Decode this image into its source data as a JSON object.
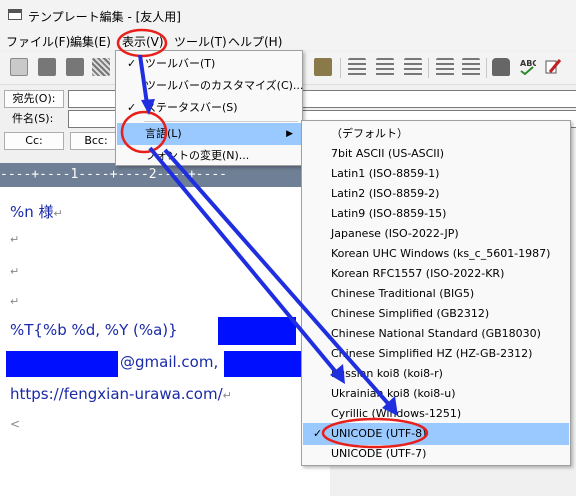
{
  "window": {
    "title": "テンプレート編集 - [友人用]"
  },
  "menubar": [
    {
      "label": "ファイル(F)"
    },
    {
      "label": "編集(E)"
    },
    {
      "label": "表示(V)"
    },
    {
      "label": "ツール(T)"
    },
    {
      "label": "ヘルプ(H)"
    }
  ],
  "header_fields": {
    "to_label": "宛先(O):",
    "subject_label": "件名(S):",
    "cc_label": "Cc:",
    "bcc_label": "Bcc:"
  },
  "view_menu": {
    "items": [
      {
        "label": "ツールバー(T)",
        "checked": true
      },
      {
        "label": "ツールバーのカスタマイズ(C)...",
        "checked": false
      },
      {
        "label": "ステータスバー(S)",
        "checked": true
      },
      {
        "label": "言語(L)",
        "checked": false,
        "submenu": true,
        "selected": true
      },
      {
        "label": "フォントの変更(N)...",
        "checked": false
      }
    ]
  },
  "language_menu": {
    "items": [
      {
        "label": "（デフォルト）",
        "checked": false
      },
      {
        "label": "7bit ASCII (US-ASCII)",
        "checked": false
      },
      {
        "label": "Latin1 (ISO-8859-1)",
        "checked": false
      },
      {
        "label": "Latin2 (ISO-8859-2)",
        "checked": false
      },
      {
        "label": "Latin9 (ISO-8859-15)",
        "checked": false
      },
      {
        "label": "Japanese (ISO-2022-JP)",
        "checked": false
      },
      {
        "label": "Korean UHC Windows (ks_c_5601-1987)",
        "checked": false
      },
      {
        "label": "Korean RFC1557 (ISO-2022-KR)",
        "checked": false
      },
      {
        "label": "Chinese Traditional (BIG5)",
        "checked": false
      },
      {
        "label": "Chinese Simplified (GB2312)",
        "checked": false
      },
      {
        "label": "Chinese National Standard (GB18030)",
        "checked": false
      },
      {
        "label": "Chinese Simplified HZ (HZ-GB-2312)",
        "checked": false
      },
      {
        "label": "Russian koi8 (koi8-r)",
        "checked": false
      },
      {
        "label": "Ukrainian koi8 (koi8-u)",
        "checked": false
      },
      {
        "label": "Cyrillic (Windows-1251)",
        "checked": false
      },
      {
        "label": "UNICODE (UTF-8)",
        "checked": true,
        "selected": true
      },
      {
        "label": "UNICODE (UTF-7)",
        "checked": false
      }
    ]
  },
  "editor": {
    "ruler": "----+----1----+----2----+----",
    "lines": {
      "l1": "%n 様",
      "l4": "%T{%b %d, %Y (%a)}",
      "l5": "@gmail.com,",
      "l6": "https://fengxian-urawa.com/",
      "l7": "<"
    },
    "return_mark": "↵",
    "check_mark": "✓",
    "submenu_arrow": "▶"
  },
  "colors": {
    "annotation": "#1f2fe0",
    "highlight_circle": "#e8201b",
    "redaction": "#0010ff",
    "ruler_bg": "#6f7f95",
    "menu_selection": "#99c9ff"
  }
}
